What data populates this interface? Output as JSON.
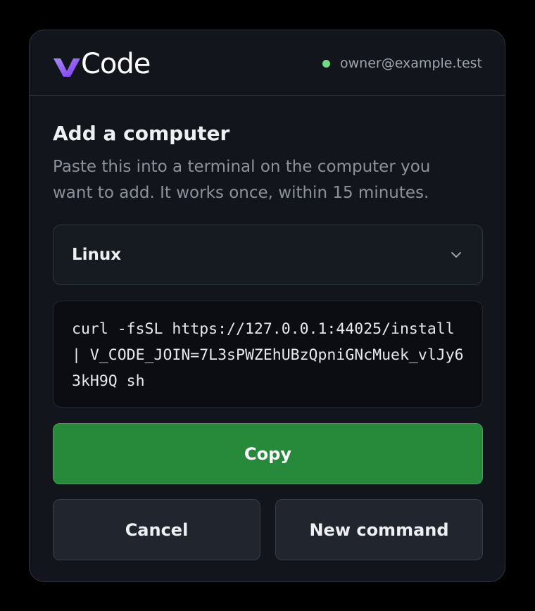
{
  "app": {
    "brand_letter": "v",
    "brand_name": "Code",
    "brand_gradient": [
      "#8b5cf6",
      "#c084fc"
    ]
  },
  "account": {
    "email": "owner@example.test",
    "status_color": "#72db82",
    "status": "online"
  },
  "dialog": {
    "title": "Add a computer",
    "description": "Paste this into a terminal on the computer you want to add. It works once, within 15 minutes."
  },
  "os_select": {
    "selected": "Linux",
    "icon": "chevron-down-icon"
  },
  "command": {
    "text": "curl -fsSL https://127.0.0.1:44025/install | V_CODE_JOIN=7L3sPWZEhUBzQpniGNcMuek_vlJy63kH9Q sh"
  },
  "buttons": {
    "copy_label": "Copy",
    "cancel_label": "Cancel",
    "new_command_label": "New command"
  },
  "colors": {
    "primary_button": "#268a3a",
    "background": "#12151b"
  }
}
